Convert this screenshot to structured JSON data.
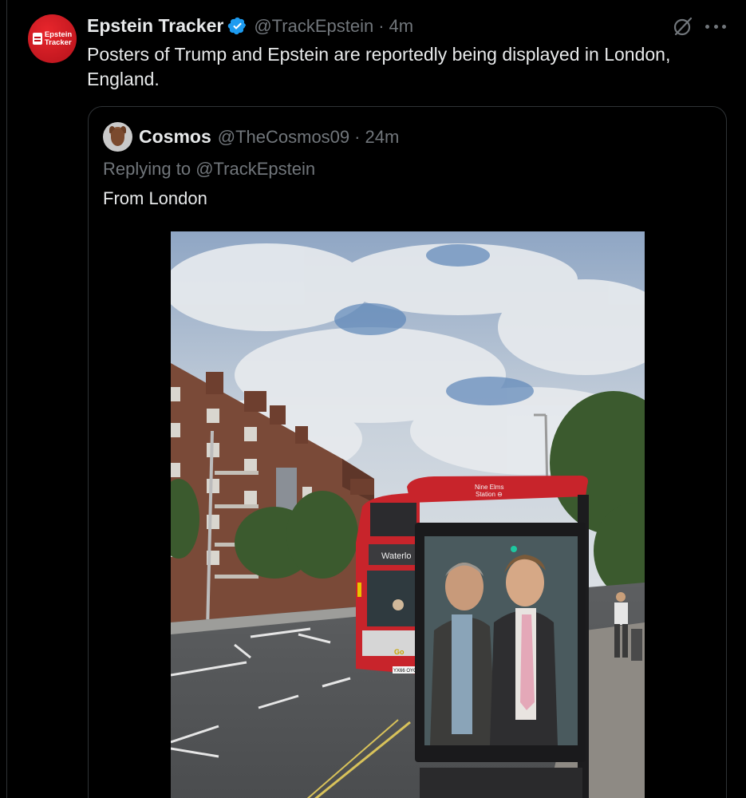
{
  "tweet": {
    "author": {
      "avatar_text": [
        "Epstein",
        "Tracker"
      ],
      "display_name": "Epstein Tracker",
      "verified": true,
      "handle": "@TrackEpstein",
      "separator": "·",
      "time": "4m"
    },
    "text": "Posters of Trump and Epstein are reportedly being displayed in London, England.",
    "actions": {
      "grok_icon": "grok-icon",
      "more_icon": "more-icon"
    }
  },
  "quote": {
    "author": {
      "display_name": "Cosmos",
      "handle": "@TheCosmos09",
      "separator": "·",
      "time": "24m"
    },
    "reply_prefix": "Replying to ",
    "reply_to": "@TrackEpstein",
    "text": "From London",
    "photo": {
      "shelter_sign_line1": "Nine Elms",
      "shelter_sign_line2": "Station ⊖",
      "bus_destination": "Waterlo",
      "bus_brand": "Go",
      "bus_plate": "YX66 OYC"
    }
  },
  "colors": {
    "background": "#000000",
    "text_primary": "#e7e9ea",
    "text_secondary": "#71767b",
    "border": "#2f3336",
    "verified_blue": "#1d9bf0",
    "brand_red": "#d4171f"
  }
}
